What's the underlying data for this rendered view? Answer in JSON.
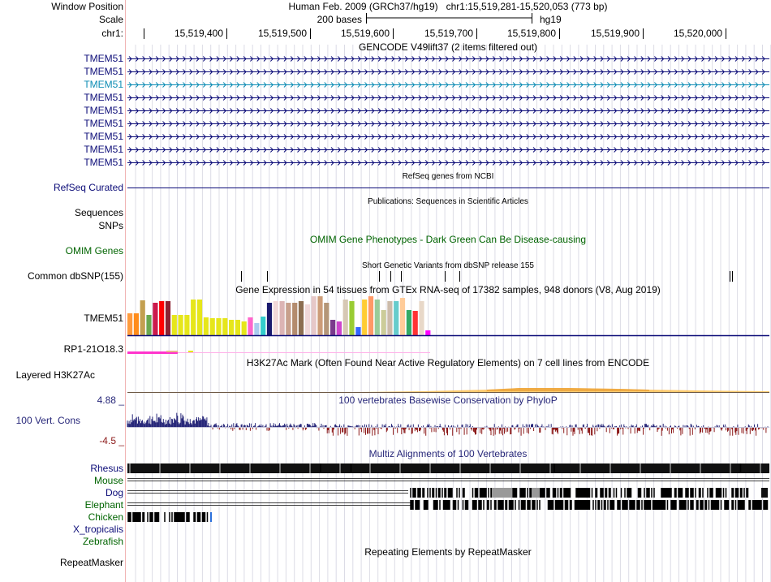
{
  "header": {
    "window_position_label": "Window Position",
    "window_position_value": "Human Feb. 2009 (GRCh37/hg19)   chr1:15,519,281-15,520,053 (773 bp)",
    "scale_label": "Scale",
    "scale_bases": "200 bases",
    "scale_assembly": "hg19",
    "chrom_label": "chr1:",
    "ruler_ticks": [
      "15,519,400",
      "15,519,500",
      "15,519,600",
      "15,519,700",
      "15,519,800",
      "15,519,900",
      "15,520,000"
    ]
  },
  "gencode": {
    "title": "GENCODE V49lift37 (2 items filtered out)",
    "transcripts": [
      {
        "name": "TMEM51",
        "color": "#0c0c78"
      },
      {
        "name": "TMEM51",
        "color": "#0c0c78"
      },
      {
        "name": "TMEM51",
        "color": "#0c8cb4"
      },
      {
        "name": "TMEM51",
        "color": "#0c0c78"
      },
      {
        "name": "TMEM51",
        "color": "#0c0c78"
      },
      {
        "name": "TMEM51",
        "color": "#0c0c78"
      },
      {
        "name": "TMEM51",
        "color": "#0c0c78"
      },
      {
        "name": "TMEM51",
        "color": "#0c0c78"
      },
      {
        "name": "TMEM51",
        "color": "#0c0c78"
      }
    ]
  },
  "refseq": {
    "title": "RefSeq genes from NCBI",
    "label": "RefSeq Curated",
    "color": "#0c0c78"
  },
  "publications": {
    "title": "Publications: Sequences in Scientific Articles",
    "label1": "Sequences",
    "label2": "SNPs"
  },
  "omim": {
    "title": "OMIM Gene Phenotypes - Dark Green Can Be Disease-causing",
    "label": "OMIM Genes",
    "color": "#006400"
  },
  "dbsnp": {
    "title": "Short Genetic Variants from dbSNP release 155",
    "label": "Common dbSNP(155)"
  },
  "gtex": {
    "title": "Gene Expression in 54 tissues from GTEx RNA-seq of 17382 samples, 948 donors (V8, Aug 2019)",
    "label": "TMEM51",
    "tissue_colors": [
      "#ff9a3c",
      "#ff8c1a",
      "#c3a050",
      "#6aa84f",
      "#cc1a4c",
      "#ff0000",
      "#8b2332",
      "#e6e61a",
      "#e6e61a",
      "#e6e61a",
      "#e6e61a",
      "#e6e61a",
      "#e6e61a",
      "#e6e61a",
      "#e6e61a",
      "#e6e61a",
      "#e6e61a",
      "#e6e61a",
      "#e6e61a",
      "#ff66cc",
      "#aaccee",
      "#33cccc",
      "#1a1a6e",
      "#f0d8d8",
      "#dcb4b4",
      "#c8a08c",
      "#b48c6e",
      "#8c6e50",
      "#f0d8d8",
      "#e6c8c8",
      "#cc9c78",
      "#b49678",
      "#7a3a8c",
      "#cc44cc",
      "#d6c8b4",
      "#99cc33",
      "#3366ff",
      "#ffcc33",
      "#ff9966",
      "#99cc99",
      "#cccc99",
      "#ccbbaa",
      "#66cccc",
      "#ffcc99",
      "#33aa66",
      "#ff3333",
      "#e8d8c8",
      "#ff00ff"
    ],
    "tissue_values": [
      0.27,
      0.27,
      0.43,
      0.25,
      0.4,
      0.42,
      0.42,
      0.25,
      0.25,
      0.25,
      0.44,
      0.44,
      0.22,
      0.21,
      0.21,
      0.21,
      0.19,
      0.19,
      0.17,
      0.22,
      0.15,
      0.23,
      0.4,
      0.42,
      0.42,
      0.4,
      0.4,
      0.42,
      0.38,
      0.48,
      0.48,
      0.4,
      0.19,
      0.17,
      0.44,
      0.42,
      0.1,
      0.44,
      0.48,
      0.44,
      0.31,
      0.42,
      0.42,
      0.46,
      0.31,
      0.3,
      0.42,
      0.06
    ]
  },
  "lncrna": {
    "label": "RP1-21O18.3",
    "color": "#ff33cc"
  },
  "h3k27ac": {
    "title": "H3K27Ac Mark (Often Found Near Active Regulatory Elements) on 7 cell lines from ENCODE",
    "label": "Layered H3K27Ac"
  },
  "conservation": {
    "title": "100 vertebrates Basewise Conservation by PhyloP",
    "label": "100 Vert. Cons",
    "max_label": "4.88 _",
    "min_label": "-4.5 _",
    "pos_color": "#28287a",
    "neg_color": "#8c1a1a"
  },
  "multiz": {
    "title": "Multiz Alignments of 100 Vertebrates",
    "species": [
      {
        "name": "Rhesus",
        "color": "#0c0c78"
      },
      {
        "name": "Mouse",
        "color": "#006400"
      },
      {
        "name": "Dog",
        "color": "#0c0c78"
      },
      {
        "name": "Elephant",
        "color": "#006400"
      },
      {
        "name": "Chicken",
        "color": "#006400"
      },
      {
        "name": "X_tropicalis",
        "color": "#0c0c78"
      },
      {
        "name": "Zebrafish",
        "color": "#006400"
      }
    ]
  },
  "repeatmasker": {
    "title": "Repeating Elements by RepeatMasker",
    "label": "RepeatMasker"
  }
}
